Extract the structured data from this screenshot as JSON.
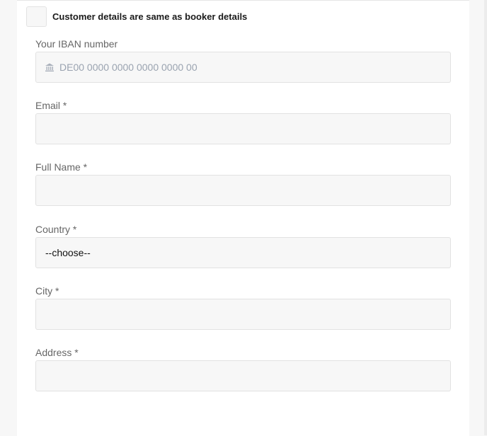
{
  "same_as_booker": {
    "label": "Customer details are same as booker details",
    "checked": false
  },
  "fields": {
    "iban": {
      "label": "Your IBAN number",
      "placeholder": "DE00 0000 0000 0000 0000 00",
      "icon": "bank-icon"
    },
    "email": {
      "label": "Email *",
      "value": ""
    },
    "full_name": {
      "label": "Full Name *",
      "value": ""
    },
    "country": {
      "label": "Country *",
      "selected": "--choose--"
    },
    "city": {
      "label": "City *",
      "value": ""
    },
    "address": {
      "label": "Address *",
      "value": ""
    }
  },
  "colors": {
    "input_bg": "#f7f7f7",
    "input_border": "#e2e2e2",
    "label": "#666666",
    "placeholder": "#9aa3b0"
  }
}
